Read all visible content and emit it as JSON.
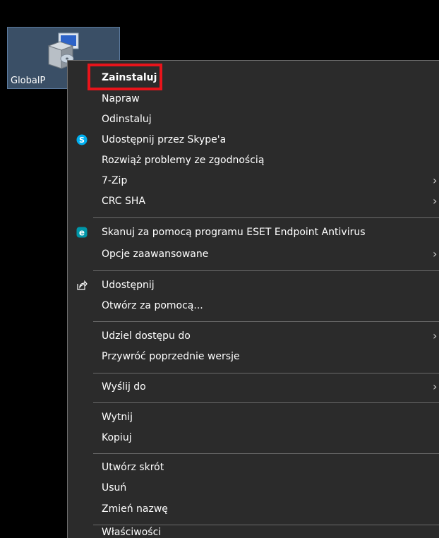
{
  "desktop_icon": {
    "label": "GlobalP",
    "icon": "installer-package-icon"
  },
  "context_menu": {
    "items": [
      {
        "label": "Zainstaluj",
        "bold": true
      },
      {
        "label": "Napraw"
      },
      {
        "label": "Odinstaluj"
      },
      {
        "label": "Udostępnij przez Skype'a",
        "icon": "skype-icon"
      },
      {
        "label": "Rozwiąż problemy ze zgodnością"
      },
      {
        "label": "7-Zip",
        "submenu": true
      },
      {
        "label": "CRC SHA",
        "submenu": true
      },
      {
        "label": "Skanuj za pomocą programu ESET Endpoint Antivirus",
        "icon": "eset-icon"
      },
      {
        "label": "Opcje zaawansowane",
        "submenu": true
      },
      {
        "label": "Udostępnij",
        "icon": "share-icon"
      },
      {
        "label": "Otwórz za pomocą..."
      },
      {
        "label": "Udziel dostępu do",
        "submenu": true
      },
      {
        "label": "Przywróć poprzednie wersje"
      },
      {
        "label": "Wyślij do",
        "submenu": true
      },
      {
        "label": "Wytnij"
      },
      {
        "label": "Kopiuj"
      },
      {
        "label": "Utwórz skrót"
      },
      {
        "label": "Usuń"
      },
      {
        "label": "Zmień nazwę"
      },
      {
        "label": "Właściwości"
      }
    ],
    "submenu_arrow": "›"
  },
  "highlight": {
    "target": "Zainstaluj",
    "color": "#e8141b"
  },
  "colors": {
    "menu_bg": "#2b2b2b",
    "desktop_bg": "#000000",
    "icon_selection": "#3a4f66",
    "skype": "#00aff0",
    "eset": "#0096a8"
  }
}
